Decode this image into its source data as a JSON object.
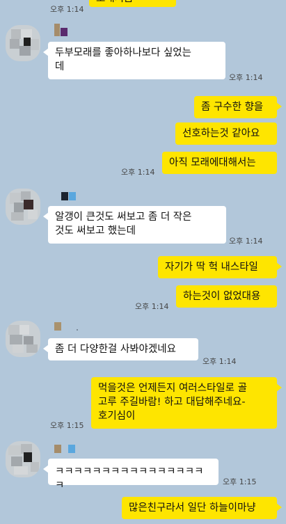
{
  "messages": [
    {
      "text": "모래지뭄",
      "time": "오후 1:14"
    },
    {
      "text": "두부모래를 좋아하나보다 싶었는\n데",
      "time": "오후 1:14"
    },
    {
      "text": "좀 구수한 향을"
    },
    {
      "text": "선호하는것 같아요"
    },
    {
      "text": "아직 모래에대해서는",
      "time": "오후 1:14"
    },
    {
      "text": "알갱이 큰것도 써보고 좀 더 작은\n것도 써보고 했는데",
      "time": "오후 1:14"
    },
    {
      "text": "자기가 딱 헉 내스타일"
    },
    {
      "text": "하는것이 없었대용",
      "time": "오후 1:14"
    },
    {
      "text": "좀 더 다양한걸 사봐야겠네요",
      "time": "오후 1:14"
    },
    {
      "text": "먹을것은 언제든지 여러스타일로 골\n고루 주길바람! 하고 대답해주네요-\n호기심이",
      "time": "오후 1:15"
    },
    {
      "text": "ㅋㅋㅋㅋㅋㅋㅋㅋㅋㅋㅋㅋㅋㅋㅋㅋㅋ",
      "time": "오후 1:15"
    },
    {
      "text": "많은친구라서 일단 하늘이마냥"
    }
  ],
  "colors": {
    "background": "#b2c7da",
    "incoming_bubble": "#ffffff",
    "outgoing_bubble": "#fee500"
  }
}
